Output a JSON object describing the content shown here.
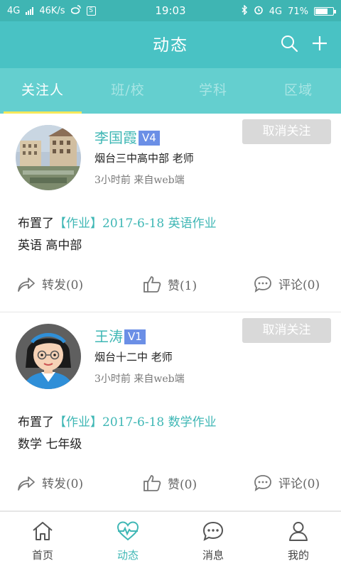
{
  "status_bar": {
    "network": "4G",
    "speed": "46K/s",
    "time": "19:03",
    "right_network": "4G",
    "battery": "71%",
    "battery_level": 0.71
  },
  "header": {
    "title": "动态",
    "search_icon": "search-icon",
    "add_icon": "plus-icon"
  },
  "tabs": [
    {
      "label": "关注人",
      "active": true
    },
    {
      "label": "班/校",
      "active": false
    },
    {
      "label": "学科",
      "active": false
    },
    {
      "label": "区域",
      "active": false
    }
  ],
  "posts": [
    {
      "name": "李国霞",
      "level": "V4",
      "org": "烟台三中高中部 老师",
      "meta": "3小时前 来自web端",
      "unfollow_label": "取消关注",
      "text_prefix": "布置了",
      "text_tag": "【作业】2017-6-18 英语作业",
      "text_line2": "英语 高中部",
      "share_label": "转发(0)",
      "like_label": "赞(1)",
      "comment_label": "评论(0)"
    },
    {
      "name": "王涛",
      "level": "V1",
      "org": "烟台十二中 老师",
      "meta": "3小时前 来自web端",
      "unfollow_label": "取消关注",
      "text_prefix": "布置了",
      "text_tag": "【作业】2017-6-18 数学作业",
      "text_line2": "数学 七年级",
      "share_label": "转发(0)",
      "like_label": "赞(0)",
      "comment_label": "评论(0)"
    }
  ],
  "bottom_nav": [
    {
      "label": "首页",
      "icon": "home-icon",
      "active": false
    },
    {
      "label": "动态",
      "icon": "heartbeat-icon",
      "active": true
    },
    {
      "label": "消息",
      "icon": "chat-icon",
      "active": false
    },
    {
      "label": "我的",
      "icon": "person-icon",
      "active": false
    }
  ],
  "colors": {
    "accent": "#49c2c4",
    "tab_bar": "#64cfcf",
    "tab_indicator": "#f5e85a",
    "level_badge": "#6b8fe6"
  }
}
